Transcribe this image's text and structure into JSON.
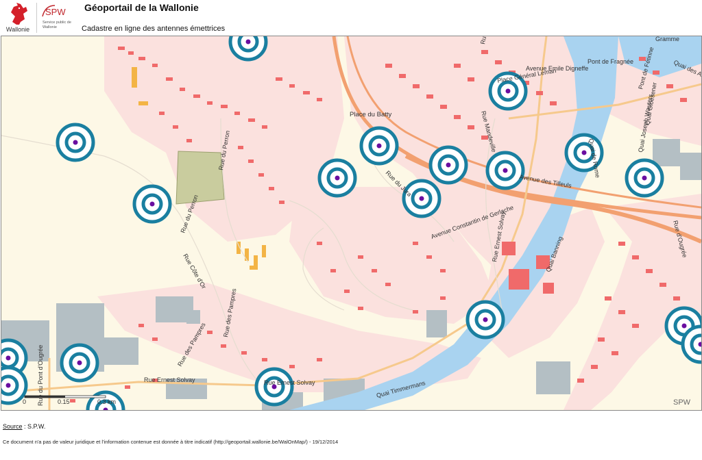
{
  "header": {
    "title": "Géoportail de la Wallonie",
    "subtitle": "Cadastre en ligne des antennes émettrices",
    "region_logo_label": "Wallonie",
    "spw_logo_text": "SPW",
    "spw_logo_subtext": "Service public de Wallonie"
  },
  "map": {
    "watermark": "SPW",
    "scale_bar": {
      "ticks": [
        "0",
        "0.15",
        "0.3 km"
      ]
    },
    "street_labels": [
      "Rue du Perron",
      "Rue du Perron",
      "Rue Côte d'Or",
      "Rue des Pampres",
      "Rue des Pampres",
      "Rue Ernest Solvay",
      "Rue Ernest Solvay",
      "Rue du Pont d'Ougrée",
      "Quai Timmermans",
      "Avenue Constantin de Gerlache",
      "Rue Ernest Solvay",
      "Quai Banning",
      "Avenue des Tilleuls",
      "Avenue Emile Digneffe",
      "Rue Mandeville",
      "Pont de Fragnée",
      "Quai Joseph Wauters",
      "Quai Gloesener",
      "Pont de Fétinne",
      "Quai des Ardennes",
      "Gramme",
      "Rue d'Ougrée",
      "Place du Batty",
      "Rue du Jura",
      "Rue Auguste Donnay",
      "Place Général Leman",
      "Quai de Rome"
    ],
    "antenna_count": 19
  },
  "footer": {
    "source_label": "Source",
    "source_value": ": S.P.W.",
    "disclaimer": "Ce document n'a pas de valeur juridique et l'information contenue est donnée à titre indicatif (http://geoportail.wallonie.be/WalOnMap/) - 19/12/2014"
  },
  "colors": {
    "antenna_ring": "#1a7fa0",
    "antenna_center": "#6a0ea0",
    "river": "#a9d3f0",
    "buildings": "#f06a6a",
    "railway": "#f2a070",
    "industrial": "#b4bfc4"
  }
}
